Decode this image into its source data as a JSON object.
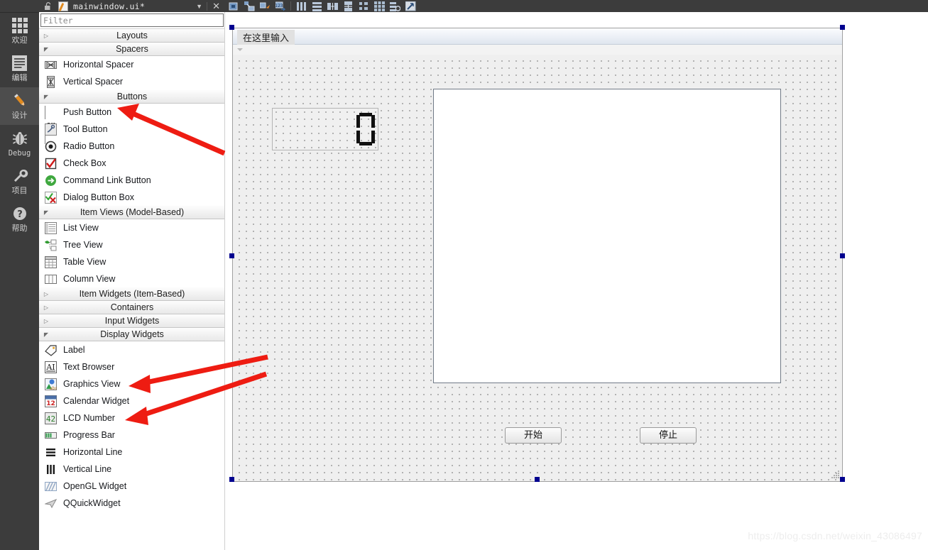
{
  "modebar": {
    "items": [
      {
        "label": "欢迎",
        "icon": "welcome-grid-icon",
        "active": false
      },
      {
        "label": "编辑",
        "icon": "edit-document-icon",
        "active": false
      },
      {
        "label": "设计",
        "icon": "design-pencil-icon",
        "active": true
      },
      {
        "label": "Debug",
        "icon": "debug-bug-icon",
        "active": false
      },
      {
        "label": "项目",
        "icon": "projects-wrench-icon",
        "active": false
      },
      {
        "label": "帮助",
        "icon": "help-question-icon",
        "active": false
      }
    ]
  },
  "widgetbox": {
    "titlebar": {
      "lock_icon": "unlocked-padlock-icon",
      "file_icon": "ui-file-pencil-icon",
      "filename": "mainwindow.ui*",
      "dropdown_icon": "chevron-down-icon",
      "close_icon": "close-icon"
    },
    "filter": {
      "placeholder": "Filter",
      "value": ""
    },
    "groups": [
      {
        "label": "Layouts",
        "expanded": false,
        "items": []
      },
      {
        "label": "Spacers",
        "expanded": true,
        "items": [
          {
            "label": "Horizontal Spacer",
            "icon": "horizontal-spacer-icon"
          },
          {
            "label": "Vertical Spacer",
            "icon": "vertical-spacer-icon"
          }
        ]
      },
      {
        "label": "Buttons",
        "expanded": true,
        "items": [
          {
            "label": "Push Button",
            "icon": "push-button-icon"
          },
          {
            "label": "Tool Button",
            "icon": "tool-button-icon"
          },
          {
            "label": "Radio Button",
            "icon": "radio-button-icon"
          },
          {
            "label": "Check Box",
            "icon": "check-box-icon"
          },
          {
            "label": "Command Link Button",
            "icon": "command-link-button-icon"
          },
          {
            "label": "Dialog Button Box",
            "icon": "dialog-button-box-icon"
          }
        ]
      },
      {
        "label": "Item Views (Model-Based)",
        "expanded": true,
        "items": [
          {
            "label": "List View",
            "icon": "list-view-icon"
          },
          {
            "label": "Tree View",
            "icon": "tree-view-icon"
          },
          {
            "label": "Table View",
            "icon": "table-view-icon"
          },
          {
            "label": "Column View",
            "icon": "column-view-icon"
          }
        ]
      },
      {
        "label": "Item Widgets (Item-Based)",
        "expanded": false,
        "items": []
      },
      {
        "label": "Containers",
        "expanded": false,
        "items": []
      },
      {
        "label": "Input Widgets",
        "expanded": false,
        "items": []
      },
      {
        "label": "Display Widgets",
        "expanded": true,
        "items": [
          {
            "label": "Label",
            "icon": "label-icon"
          },
          {
            "label": "Text Browser",
            "icon": "text-browser-icon"
          },
          {
            "label": "Graphics View",
            "icon": "graphics-view-icon"
          },
          {
            "label": "Calendar Widget",
            "icon": "calendar-widget-icon"
          },
          {
            "label": "LCD Number",
            "icon": "lcd-number-icon"
          },
          {
            "label": "Progress Bar",
            "icon": "progress-bar-icon"
          },
          {
            "label": "Horizontal Line",
            "icon": "horizontal-line-icon"
          },
          {
            "label": "Vertical Line",
            "icon": "vertical-line-icon"
          },
          {
            "label": "OpenGL Widget",
            "icon": "opengl-widget-icon"
          },
          {
            "label": "QQuickWidget",
            "icon": "qquickwidget-icon"
          }
        ]
      }
    ]
  },
  "toolbar": {
    "buttons": [
      {
        "name": "edit-widgets-icon",
        "title": "Edit Widgets"
      },
      {
        "name": "edit-signals-slots-icon",
        "title": "Edit Signals/Slots"
      },
      {
        "name": "edit-buddies-icon",
        "title": "Edit Buddies"
      },
      {
        "name": "edit-tab-order-icon",
        "title": "Edit Tab Order"
      },
      {
        "name": "layout-horizontally-icon",
        "title": "Lay Out Horizontally"
      },
      {
        "name": "layout-vertically-icon",
        "title": "Lay Out Vertically"
      },
      {
        "name": "layout-splitter-horizontal-icon",
        "title": "Lay Out Horizontally in Splitter"
      },
      {
        "name": "layout-splitter-vertical-icon",
        "title": "Lay Out Vertically in Splitter"
      },
      {
        "name": "layout-form-icon",
        "title": "Lay Out in a Form Layout"
      },
      {
        "name": "layout-grid-icon",
        "title": "Lay Out in a Grid"
      },
      {
        "name": "break-layout-icon",
        "title": "Break Layout"
      },
      {
        "name": "adjust-size-icon",
        "title": "Adjust Size"
      }
    ]
  },
  "form": {
    "menubar_placeholder": "在这里输入",
    "lcd": {
      "name": "lcdNumber",
      "value": "0",
      "digits": 1
    },
    "graphics_view": {
      "name": "graphicsView"
    },
    "buttons": [
      {
        "label": "开始",
        "name": "start-button"
      },
      {
        "label": "停止",
        "name": "stop-button"
      }
    ]
  },
  "annotations": {
    "arrow_color": "#ee1c12",
    "arrows": [
      {
        "target": "Push Button"
      },
      {
        "target": "Graphics View"
      },
      {
        "target": "LCD Number"
      }
    ]
  },
  "watermark": {
    "text": "https://blog.csdn.net/weixin_43086497"
  },
  "colors": {
    "chrome_dark": "#3c3c3c",
    "mode_active": "#4d4d4d",
    "canvas_grid": "#efefef",
    "selection_handle": "#00008f",
    "arrow_red": "#ee1c12"
  }
}
